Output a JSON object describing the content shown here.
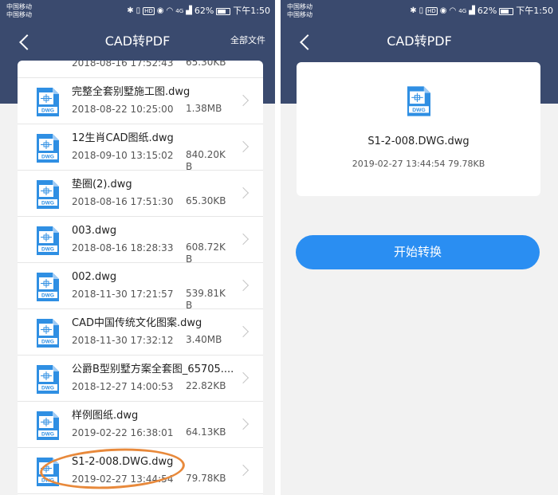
{
  "status": {
    "carrier_line1": "中国移动",
    "carrier_line2": "中国移动",
    "signal_text": "4G",
    "battery": "62%",
    "time": "下午1:50",
    "hd": "HD"
  },
  "left": {
    "title": "CAD转PDF",
    "all_files": "全部文件",
    "files": [
      {
        "name": "",
        "time": "2018-08-16 17:52:43",
        "size": "65.30KB"
      },
      {
        "name": "完整全套别墅施工图.dwg",
        "time": "2018-08-22 10:25:00",
        "size": "1.38MB"
      },
      {
        "name": "12生肖CAD图纸.dwg",
        "time": "2018-09-10 13:15:02",
        "size": "840.20KB"
      },
      {
        "name": "垫圈(2).dwg",
        "time": "2018-08-16 17:51:30",
        "size": "65.30KB"
      },
      {
        "name": "003.dwg",
        "time": "2018-08-16 18:28:33",
        "size": "608.72KB"
      },
      {
        "name": "002.dwg",
        "time": "2018-11-30 17:21:57",
        "size": "539.81KB"
      },
      {
        "name": "CAD中国传统文化图案.dwg",
        "time": "2018-11-30 17:32:12",
        "size": "3.40MB"
      },
      {
        "name": "公爵B型别墅方案全套图_65705....",
        "time": "2018-12-27 14:00:53",
        "size": "22.82KB"
      },
      {
        "name": "样例图纸.dwg",
        "time": "2019-02-22 16:38:01",
        "size": "64.13KB"
      },
      {
        "name": "S1-2-008.DWG.dwg",
        "time": "2019-02-27 13:44:54",
        "size": "79.78KB"
      }
    ]
  },
  "right": {
    "title": "CAD转PDF",
    "file_name": "S1-2-008.DWG.dwg",
    "file_meta": "2019-02-27 13:44:54   79.78KB",
    "convert_label": "开始转换"
  },
  "icon_label": "DWG",
  "colors": {
    "header": "#3a4a6e",
    "accent": "#2a8ef2",
    "annotation": "#e8893b",
    "icon_blue": "#2f8fe3"
  },
  "icons": [
    "back-arrow-icon",
    "chevron-right-icon",
    "dwg-file-icon",
    "battery-icon",
    "wifi-icon",
    "bluetooth-icon"
  ]
}
